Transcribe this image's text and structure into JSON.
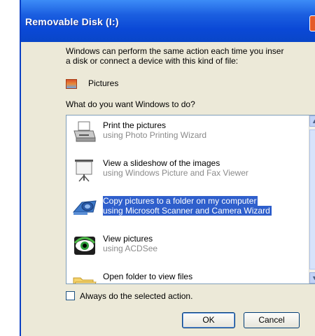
{
  "window": {
    "title": "Removable Disk (I:)"
  },
  "intro": {
    "line1": "Windows can perform the same action each time you inser",
    "line2": "a disk or connect a device with this kind of file:"
  },
  "content_type": {
    "icon": "pictures-icon",
    "label": "Pictures"
  },
  "question": "What do you want Windows to do?",
  "actions": [
    {
      "name": "Print the pictures",
      "sub": "using Photo Printing Wizard",
      "icon": "printer-icon",
      "selected": false
    },
    {
      "name": "View a slideshow of the images",
      "sub": "using Windows Picture and Fax Viewer",
      "icon": "projector-screen-icon",
      "selected": false
    },
    {
      "name": "Copy pictures to a folder on my computer",
      "sub": "using Microsoft Scanner and Camera Wizard",
      "icon": "camera-icon",
      "selected": true
    },
    {
      "name": "View pictures",
      "sub": "using ACDSee",
      "icon": "eye-icon",
      "selected": false
    },
    {
      "name": "Open folder to view files",
      "sub": "",
      "icon": "folder-icon",
      "selected": false
    }
  ],
  "always_checkbox": {
    "label": "Always do the selected action.",
    "checked": false
  },
  "buttons": {
    "ok": "OK",
    "cancel": "Cancel"
  }
}
